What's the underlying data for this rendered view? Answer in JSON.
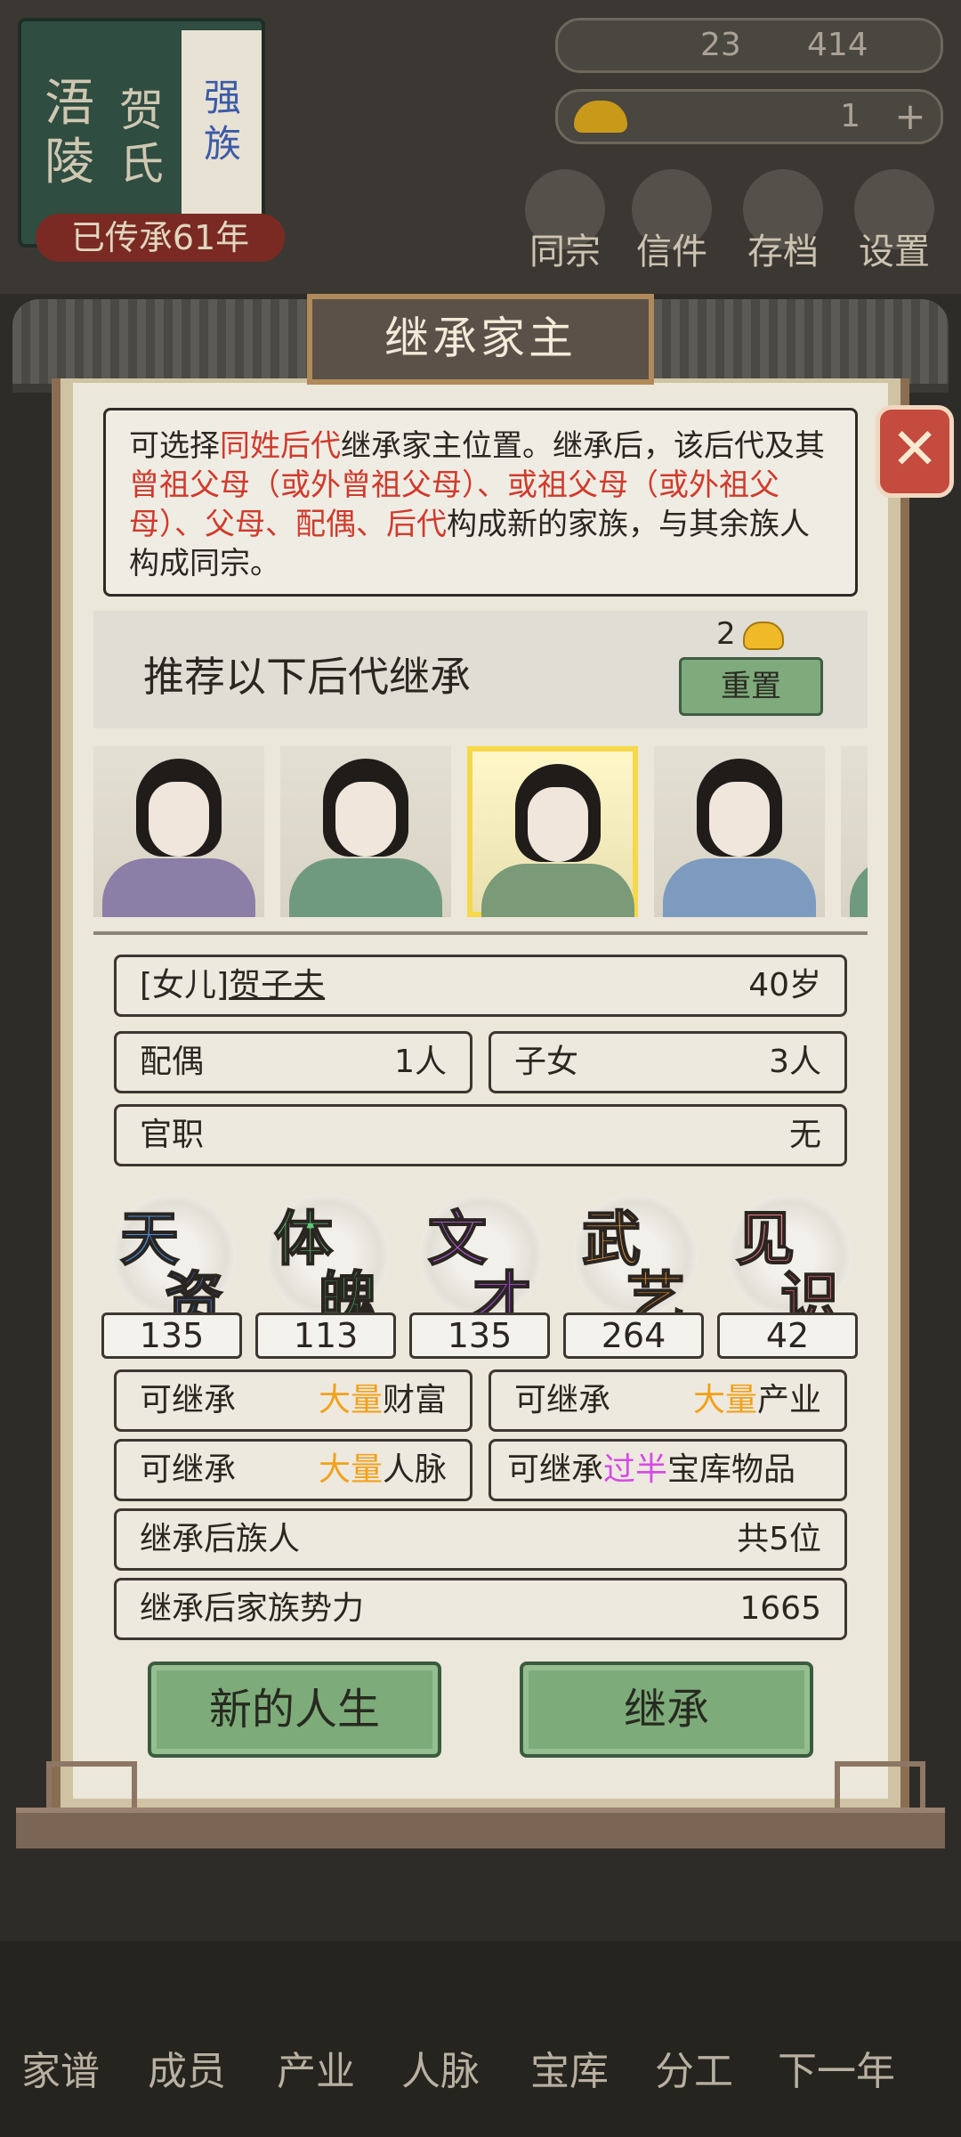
{
  "topbar": {
    "clan_title_chars": [
      "浯",
      "陵"
    ],
    "clan_surname_chars": [
      "贺",
      "氏"
    ],
    "clan_rank_chars": [
      "强",
      "族"
    ],
    "years_passed": "已传承61年",
    "resource_a": "23",
    "resource_b": "414",
    "gold_count": "1",
    "nav": [
      "同宗",
      "信件",
      "存档",
      "设置"
    ]
  },
  "dialog": {
    "title": "继承家主",
    "desc": {
      "p1": "可选择",
      "r1": "同姓后代",
      "p2": "继承家主位置。继承后，该后代及其",
      "r2": "曾祖父母（或外曾祖父母）、或祖父母（或外祖父母）、父母、配偶、后代",
      "p3": "构成新的家族，与其余族人构成同宗。"
    },
    "recommend_text": "推荐以下后代继承",
    "reset_cost": "2",
    "reset_label": "重置",
    "heir": {
      "title_relation": "[女儿]",
      "name": "贺子夫",
      "age": "40岁",
      "spouse_label": "配偶",
      "spouse_value": "1人",
      "children_label": "子女",
      "children_value": "3人",
      "office_label": "官职",
      "office_value": "无"
    },
    "stats": [
      {
        "c1": "天",
        "c2": "资",
        "value": "135",
        "color1": "#4a8fe0",
        "color2": "#3b74d1"
      },
      {
        "c1": "体",
        "c2": "魄",
        "value": "113",
        "color1": "#5bc77a",
        "color2": "#3fae64"
      },
      {
        "c1": "文",
        "c2": "才",
        "value": "135",
        "color1": "#b45ce0",
        "color2": "#9a45d0"
      },
      {
        "c1": "武",
        "c2": "艺",
        "value": "264",
        "color1": "#f2a34a",
        "color2": "#e08a2a"
      },
      {
        "c1": "见",
        "c2": "识",
        "value": "42",
        "color1": "#f07a86",
        "color2": "#e25d6d"
      }
    ],
    "inherit": {
      "wealth_prefix": "可继承",
      "wealth_hl": "大量",
      "wealth_suffix": "财富",
      "industry_prefix": "可继承",
      "industry_hl": "大量",
      "industry_suffix": "产业",
      "network_prefix": "可继承",
      "network_hl": "大量",
      "network_suffix": "人脉",
      "treasury_prefix": "可继承",
      "treasury_hl": "过半",
      "treasury_suffix": "宝库物品"
    },
    "after_members_label": "继承后族人",
    "after_members_value": "共5位",
    "after_power_label": "继承后家族势力",
    "after_power_value": "1665",
    "new_life_label": "新的人生",
    "inherit_label": "继承"
  },
  "bottom_nav": [
    "家谱",
    "成员",
    "产业",
    "人脉",
    "宝库",
    "分工",
    "下一年"
  ],
  "colors": {
    "accent_green": "#7dab79",
    "highlight_red": "#d03b2c",
    "highlight_orange": "#f2a11a",
    "highlight_purple": "#d54ce3"
  }
}
